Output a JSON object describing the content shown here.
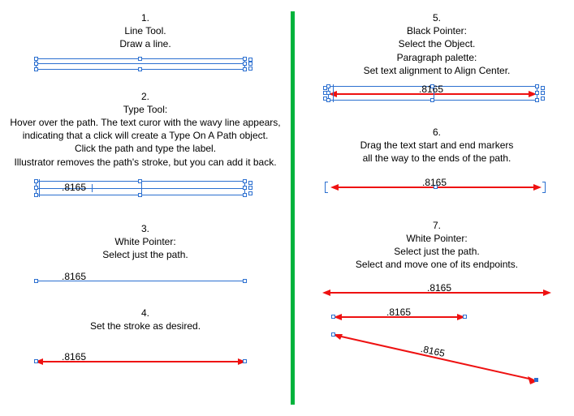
{
  "dim_label": ".8165",
  "steps": {
    "s1": {
      "num": "1.",
      "title": "Line Tool.",
      "body": "Draw a line."
    },
    "s2": {
      "num": "2.",
      "title": "Type Tool:",
      "l1": "Hover over the path. The text curor with the wavy line appears,",
      "l2": "indicating that a click will create a Type On A Path object.",
      "l3": "Click the path and type the label.",
      "l4": "Illustrator removes the path's stroke, but you can add it back."
    },
    "s3": {
      "num": "3.",
      "title": "White Pointer:",
      "body": "Select just the path."
    },
    "s4": {
      "num": "4.",
      "body": "Set the stroke as desired."
    },
    "s5": {
      "num": "5.",
      "title": "Black Pointer:",
      "l1": "Select the Object.",
      "l2": "Paragraph palette:",
      "l3": "Set text alignment to Align Center."
    },
    "s6": {
      "num": "6.",
      "l1": "Drag the text start and end markers",
      "l2": "all the way to the ends of the path."
    },
    "s7": {
      "num": "7.",
      "title": "White Pointer:",
      "l1": "Select just the path.",
      "l2": "Select and move one of its endpoints."
    }
  }
}
